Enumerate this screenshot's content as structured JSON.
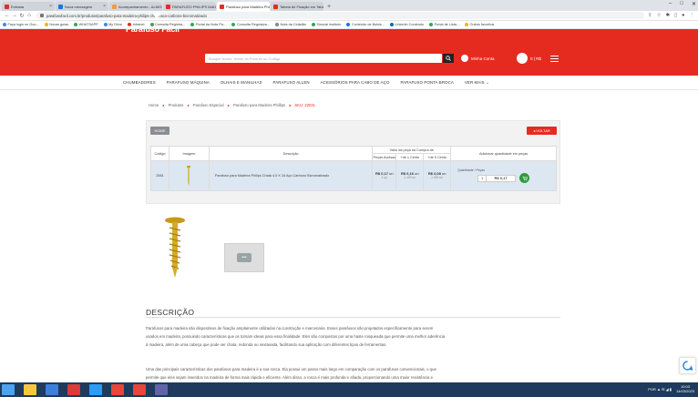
{
  "browser": {
    "tabs": [
      {
        "label": "Entrada",
        "color": "#d93025",
        "active": false
      },
      {
        "label": "Nova mensagem",
        "color": "#1a73e8",
        "active": false
      },
      {
        "label": "Acompanhamento - ALMOXA",
        "color": "#f2994a",
        "active": false
      },
      {
        "label": "PARAFUSO PHILIPS MADEI",
        "color": "#e52b1f",
        "active": false
      },
      {
        "label": "Parafuso para Madeira Philips",
        "color": "#e52b1f",
        "active": true
      },
      {
        "label": "Tabela de Fixação em Tabela",
        "color": "#e52b1f",
        "active": false
      }
    ],
    "new_tab": "+",
    "window_controls": [
      "–",
      "□",
      "✕"
    ],
    "url": "parafusofacil.com.br/produtos/parafuso-para-madeira-philips-chata-aco-carbono-bicromatizado",
    "bookmarks": [
      {
        "label": "Faça login no Goo...",
        "color": "#4285f4"
      },
      {
        "label": "Novas guias",
        "color": "#f2b600"
      },
      {
        "label": "WHATSAPP",
        "color": "#34a853"
      },
      {
        "label": "My Drive",
        "color": "#4285f4"
      },
      {
        "label": "Intranet",
        "color": "#e52b1f"
      },
      {
        "label": "Consulta Registra...",
        "color": "#34a853"
      },
      {
        "label": "Portal da Nota Fis...",
        "color": "#34a853"
      },
      {
        "label": "Consulta Regulaiza...",
        "color": "#34a853"
      },
      {
        "label": "Nota da Cidadão",
        "color": "#888888"
      },
      {
        "label": "Simulai Instituto",
        "color": "#34a853"
      },
      {
        "label": "Conteúdo de Bolsis...",
        "color": "#1a73e8"
      },
      {
        "label": "Linkedin Conteúdo",
        "color": "#0a66c2"
      },
      {
        "label": "Portal de Lista...",
        "color": "#34a853"
      },
      {
        "label": "Outros favoritos",
        "color": "#f2b600"
      }
    ]
  },
  "site": {
    "brand_color": "#e52b1f",
    "logo_text": "Parafuso Fácil",
    "search_placeholder": "Busque Nome, Nome do Produto ou Código",
    "account_label": "Minha Conta",
    "cart_label": "0 | R$",
    "categories": [
      "CHUMBADORES",
      "PARAFUSO MÁQUINA",
      "OLHAIS E MANILHAS",
      "PARAFUSO ALLEN",
      "ACESSÓRIOS PARA CABO DE AÇO",
      "PARAFUSO PONTA BROCA",
      "VER MAIS ⌄"
    ],
    "breadcrumb": {
      "items": [
        "Home",
        "Produtos",
        "Parafuso Especial",
        "Parafuso para Madeira Phillips"
      ],
      "current": "SKU: 22021"
    }
  },
  "product": {
    "home_label": "HOME",
    "back_label": "◂ VOLTAR",
    "headers": {
      "code": "Código",
      "image": "Imagem",
      "description": "Descrição",
      "price_group": "Valor da peça na Compra de",
      "price_cols": [
        "Peças Avulsas",
        "+de 1 Cento",
        "+de 5 Cento"
      ],
      "qty": "Adicionar quantidade em peças"
    },
    "row": {
      "code": "2581",
      "description": "Parafuso para Madeira Philips Chata 4.0 X 16 Aço Carbono Bicromatizado",
      "prices": [
        {
          "value": "R$ 0,17",
          "unit": "un",
          "sub": "1 up"
        },
        {
          "value": "R$ 0,16",
          "unit": "un",
          "sub": "≥ 100 un"
        },
        {
          "value": "R$ 0,08",
          "unit": "un",
          "sub": "≥ 500 un"
        }
      ],
      "qty_label": "Quantidade / Peças",
      "qty_value": "1",
      "total": "R$ 0,17"
    }
  },
  "gallery": {
    "thumb_glyph": "•••"
  },
  "description": {
    "title": "DESCRIÇÃO",
    "p1_l1": "Parafusos para madeira são dispositivos de fixação amplamente utilizados na construção e marcenaria. Esses parafusos são projetados especificamente para serem",
    "p1_l2": "usados em madeira, possuindo características que os tornam ideais para essa finalidade. Eles são compostos por uma haste rosqueada que permite uma melhor aderência",
    "p1_l3": "à madeira, além de uma cabeça que pode ser chata, redonda ou sextavada, facilitando sua aplicação com diferentes tipos de ferramentas.",
    "p2_l1": "Uma das principais características dos parafusos para madeira é a sua rosca. Ela possui um passo mais largo em comparação com os parafusos convencionais, o que",
    "p2_l2": "permite que eles sejam inseridos na madeira de forma mais rápida e eficiente. Além disso, a rosca é mais profunda e afiada, proporcionando uma maior resistência e"
  },
  "taskbar": {
    "items": [
      {
        "icon": "windows-icon",
        "color": "#4aa3f0"
      },
      {
        "icon": "explorer-icon",
        "color": "#f4c842"
      },
      {
        "icon": "outlook-icon",
        "color": "#3b7fd9"
      },
      {
        "icon": "antivirus-icon",
        "color": "#d93a3a"
      },
      {
        "icon": "skype-icon",
        "color": "#2a9df4"
      },
      {
        "icon": "chrome-icon",
        "color": "#e8453c"
      },
      {
        "icon": "chrome-active-icon",
        "color": "#e8453c"
      },
      {
        "icon": "teams-icon",
        "color": "#6264a7"
      }
    ],
    "tray": "POR  ▲  ✉  ◢  ▮",
    "time": "10:03",
    "date": "14/03/2023"
  }
}
